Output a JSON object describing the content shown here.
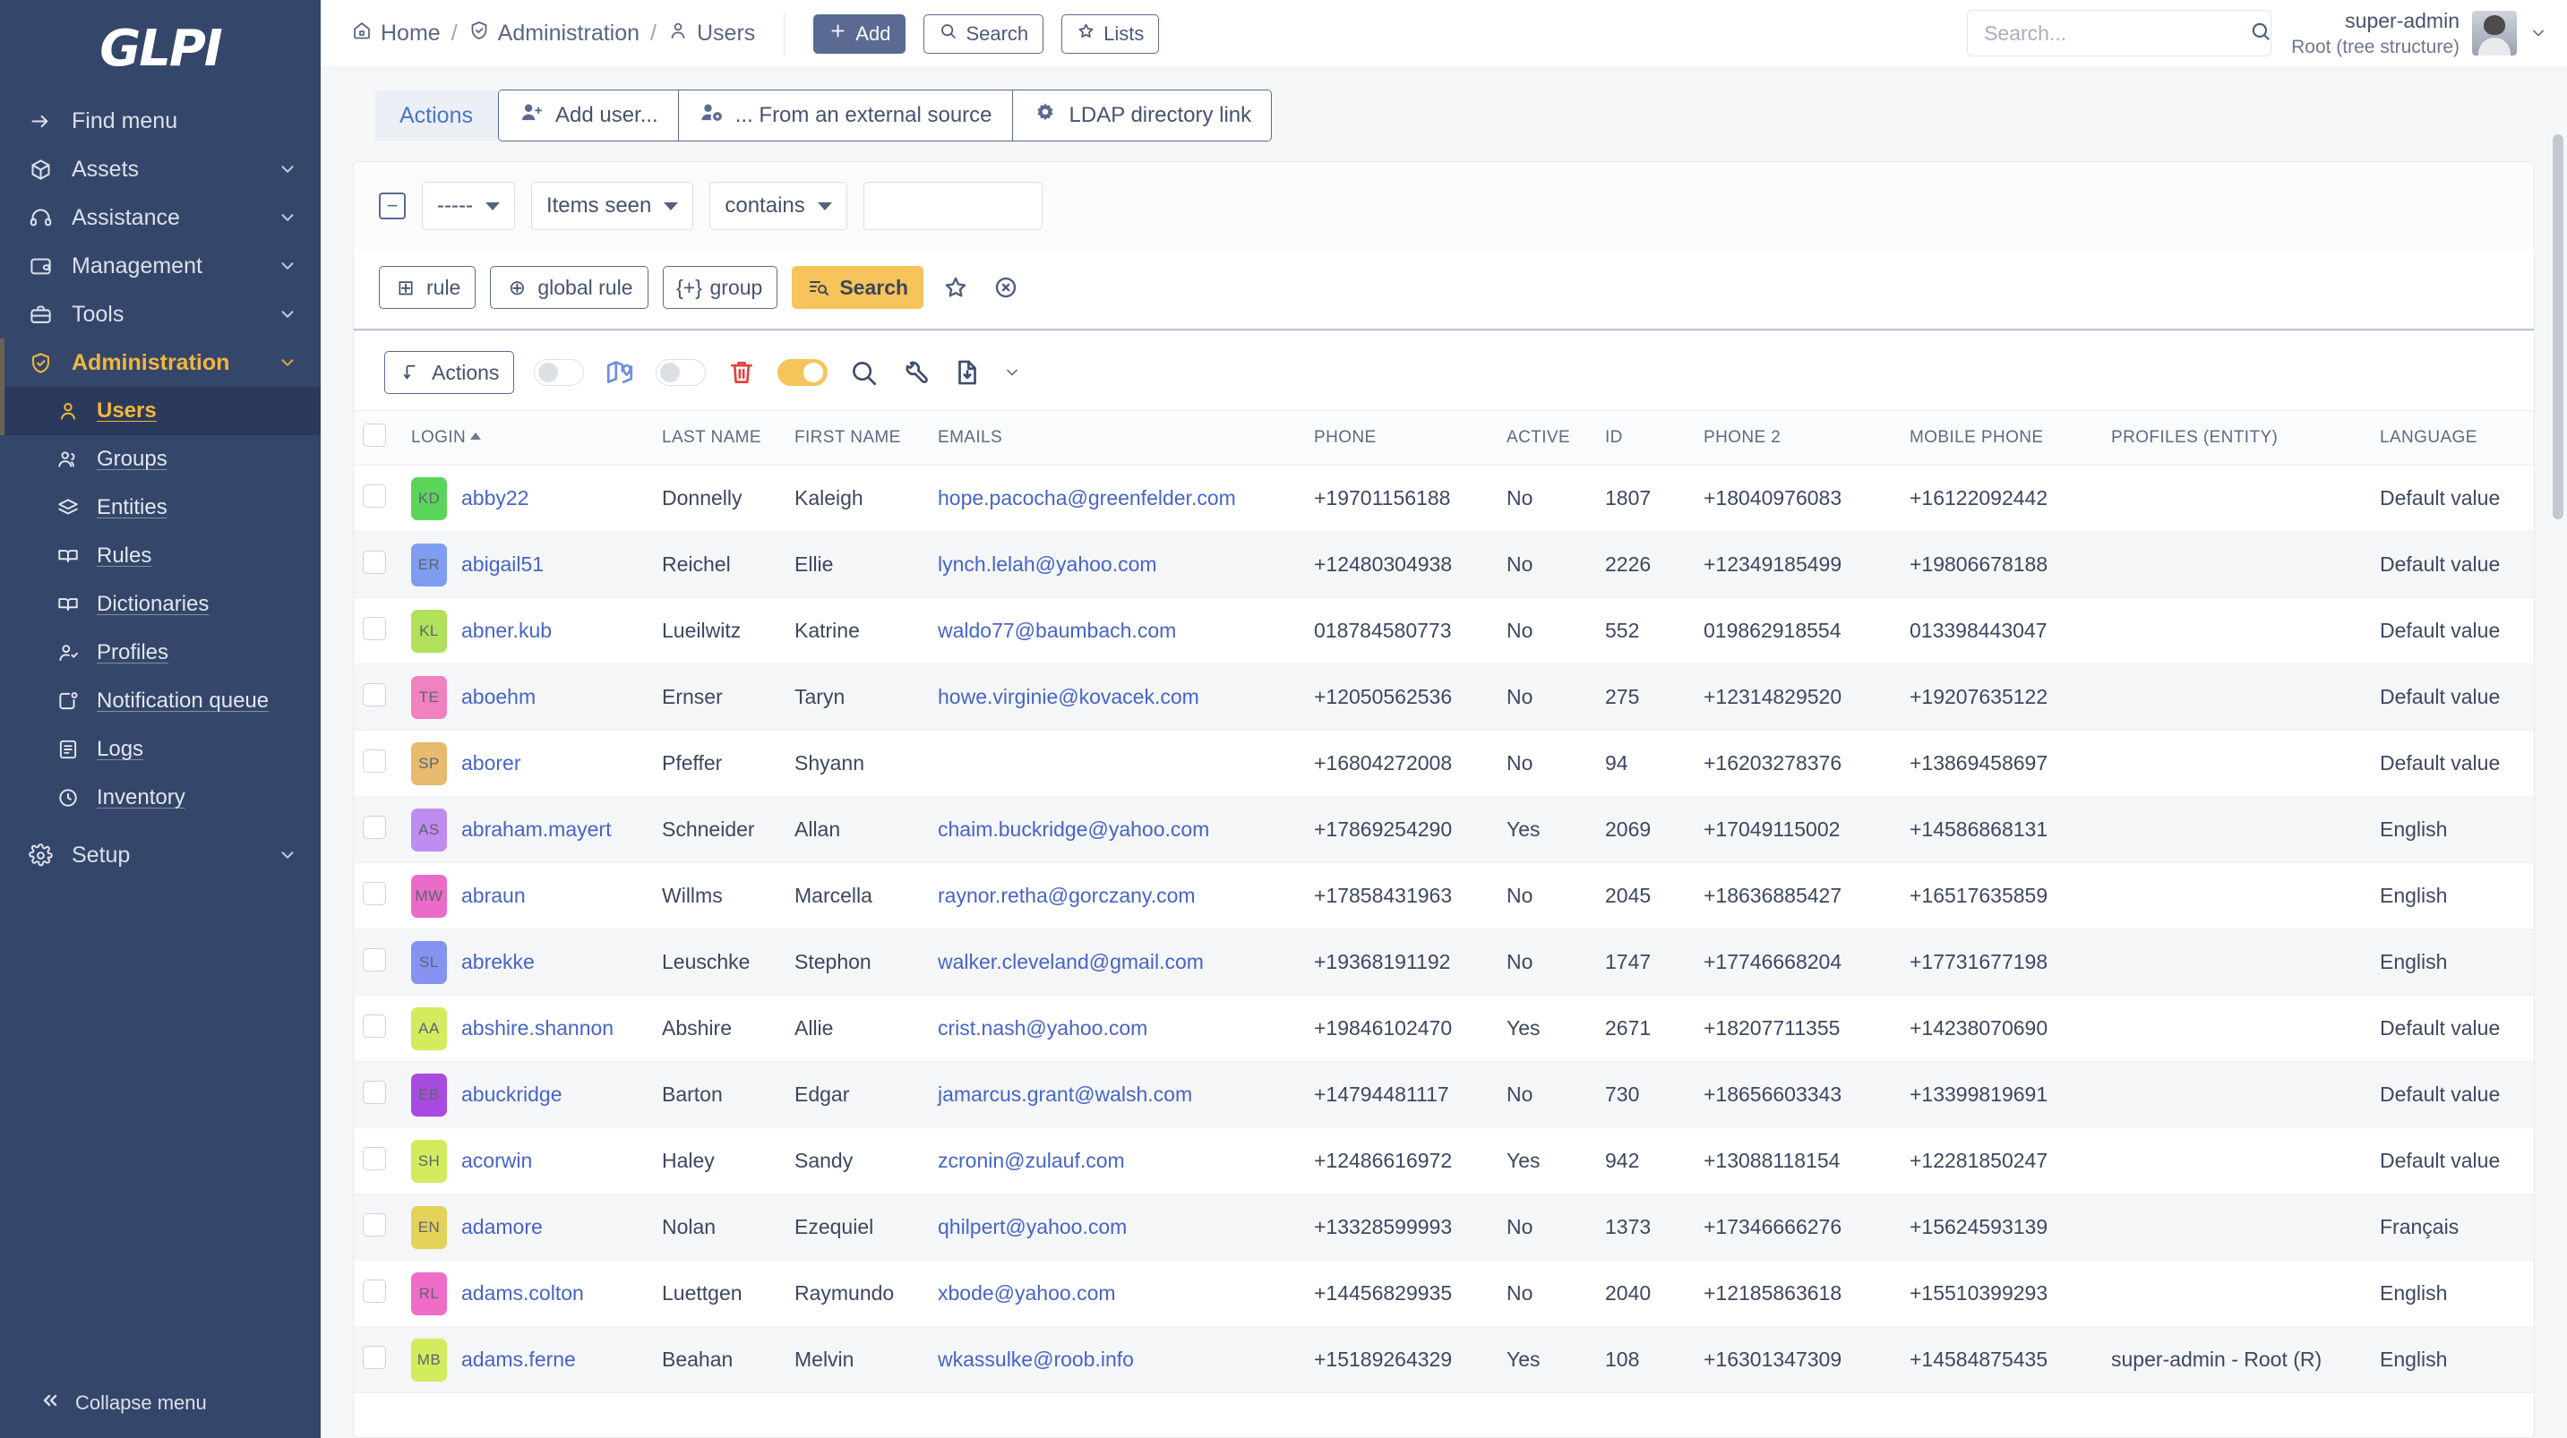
{
  "brand": {
    "logo_text": "GLPI",
    "accent": "#f2b63c",
    "sidebar_bg": "#35466b",
    "link_color": "#4664c8"
  },
  "sidebar": {
    "find_menu": "Find menu",
    "items": [
      {
        "label": "Assets",
        "icon": "box-icon"
      },
      {
        "label": "Assistance",
        "icon": "headset-icon"
      },
      {
        "label": "Management",
        "icon": "wallet-icon"
      },
      {
        "label": "Tools",
        "icon": "briefcase-icon"
      },
      {
        "label": "Administration",
        "icon": "shield-check-icon"
      }
    ],
    "sub_items": [
      {
        "label": "Users",
        "icon": "user-icon",
        "selected": true
      },
      {
        "label": "Groups",
        "icon": "users-icon",
        "selected": false
      },
      {
        "label": "Entities",
        "icon": "layers-icon",
        "selected": false
      },
      {
        "label": "Rules",
        "icon": "book-icon",
        "selected": false
      },
      {
        "label": "Dictionaries",
        "icon": "book-icon",
        "selected": false
      },
      {
        "label": "Profiles",
        "icon": "user-check-icon",
        "selected": false
      },
      {
        "label": "Notification queue",
        "icon": "notification-icon",
        "selected": false
      },
      {
        "label": "Logs",
        "icon": "file-list-icon",
        "selected": false
      },
      {
        "label": "Inventory",
        "icon": "cloud-icon",
        "selected": false
      }
    ],
    "setup": {
      "label": "Setup",
      "icon": "gear-icon"
    },
    "collapse": "Collapse menu"
  },
  "header": {
    "breadcrumb": [
      {
        "label": "Home",
        "icon": "home-icon"
      },
      {
        "label": "Administration",
        "icon": "shield-check-icon"
      },
      {
        "label": "Users",
        "icon": "user-icon"
      }
    ],
    "separator": "/",
    "buttons": [
      {
        "label": "Add",
        "icon": "plus-icon",
        "primary": true
      },
      {
        "label": "Search",
        "icon": "search-icon",
        "primary": false
      },
      {
        "label": "Lists",
        "icon": "star-icon",
        "primary": false
      }
    ],
    "search_placeholder": "Search...",
    "user": {
      "name": "super-admin",
      "entity": "Root (tree structure)"
    }
  },
  "tabs": {
    "label": "Actions",
    "buttons": [
      {
        "label": "Add user...",
        "icon": "user-plus-icon"
      },
      {
        "label": "... From an external source",
        "icon": "user-cog-icon"
      },
      {
        "label": "LDAP directory link",
        "icon": "gear-icon"
      }
    ]
  },
  "filters": {
    "collapse_glyph": "−",
    "field_select": "-----",
    "criteria_select": "Items seen",
    "operator_select": "contains",
    "value": "",
    "buttons": [
      {
        "label": "rule",
        "glyph": "⊞"
      },
      {
        "label": "global rule",
        "glyph": "⊕"
      },
      {
        "label": "group",
        "glyph": "{+}"
      }
    ],
    "search_button": "Search",
    "star_icon": "star-icon",
    "reset_icon": "reset-circle-icon"
  },
  "toolbar": {
    "actions_label": "Actions",
    "map_toggle": {
      "state": "off",
      "icon": "map-pin-icon"
    },
    "delete_toggle": {
      "state": "off",
      "icon": "trash-icon"
    },
    "search_toggle": {
      "state": "on",
      "icon": "search-icon"
    },
    "wrench_icon": "wrench-icon",
    "export_icon": "file-export-icon"
  },
  "table": {
    "columns": [
      "LOGIN",
      "LAST NAME",
      "FIRST NAME",
      "EMAILS",
      "PHONE",
      "ACTIVE",
      "ID",
      "PHONE 2",
      "MOBILE PHONE",
      "PROFILES (ENTITY)",
      "LANGUAGE"
    ],
    "sort_column": "LOGIN",
    "sort_direction": "asc",
    "rows": [
      {
        "initials": "KD",
        "color": "#5ad45a",
        "login": "abby22",
        "last_name": "Donnelly",
        "first_name": "Kaleigh",
        "email": "hope.pacocha@greenfelder.com",
        "phone": "+19701156188",
        "active": "No",
        "id": "1807",
        "phone2": "+18040976083",
        "mobile": "+16122092442",
        "profiles": "",
        "language": "Default value"
      },
      {
        "initials": "ER",
        "color": "#7f9df0",
        "login": "abigail51",
        "last_name": "Reichel",
        "first_name": "Ellie",
        "email": "lynch.lelah@yahoo.com",
        "phone": "+12480304938",
        "active": "No",
        "id": "2226",
        "phone2": "+12349185499",
        "mobile": "+19806678188",
        "profiles": "",
        "language": "Default value"
      },
      {
        "initials": "KL",
        "color": "#b3e05a",
        "login": "abner.kub",
        "last_name": "Lueilwitz",
        "first_name": "Katrine",
        "email": "waldo77@baumbach.com",
        "phone": "018784580773",
        "active": "No",
        "id": "552",
        "phone2": "019862918554",
        "mobile": "013398443047",
        "profiles": "",
        "language": "Default value"
      },
      {
        "initials": "TE",
        "color": "#ef82bf",
        "login": "aboehm",
        "last_name": "Ernser",
        "first_name": "Taryn",
        "email": "howe.virginie@kovacek.com",
        "phone": "+12050562536",
        "active": "No",
        "id": "275",
        "phone2": "+12314829520",
        "mobile": "+19207635122",
        "profiles": "",
        "language": "Default value"
      },
      {
        "initials": "SP",
        "color": "#e7ba6d",
        "login": "aborer",
        "last_name": "Pfeffer",
        "first_name": "Shyann",
        "email": "",
        "phone": "+16804272008",
        "active": "No",
        "id": "94",
        "phone2": "+16203278376",
        "mobile": "+13869458697",
        "profiles": "",
        "language": "Default value"
      },
      {
        "initials": "AS",
        "color": "#c08cef",
        "login": "abraham.mayert",
        "last_name": "Schneider",
        "first_name": "Allan",
        "email": "chaim.buckridge@yahoo.com",
        "phone": "+17869254290",
        "active": "Yes",
        "id": "2069",
        "phone2": "+17049115002",
        "mobile": "+14586868131",
        "profiles": "",
        "language": "English"
      },
      {
        "initials": "MW",
        "color": "#ea6cc8",
        "login": "abraun",
        "last_name": "Willms",
        "first_name": "Marcella",
        "email": "raynor.retha@gorczany.com",
        "phone": "+17858431963",
        "active": "No",
        "id": "2045",
        "phone2": "+18636885427",
        "mobile": "+16517635859",
        "profiles": "",
        "language": "English"
      },
      {
        "initials": "SL",
        "color": "#8592ef",
        "login": "abrekke",
        "last_name": "Leuschke",
        "first_name": "Stephon",
        "email": "walker.cleveland@gmail.com",
        "phone": "+19368191192",
        "active": "No",
        "id": "1747",
        "phone2": "+17746668204",
        "mobile": "+17731677198",
        "profiles": "",
        "language": "English"
      },
      {
        "initials": "AA",
        "color": "#d2ec5e",
        "login": "abshire.shannon",
        "last_name": "Abshire",
        "first_name": "Allie",
        "email": "crist.nash@yahoo.com",
        "phone": "+19846102470",
        "active": "Yes",
        "id": "2671",
        "phone2": "+18207711355",
        "mobile": "+14238070690",
        "profiles": "",
        "language": "Default value"
      },
      {
        "initials": "EB",
        "color": "#a94ae0",
        "login": "abuckridge",
        "last_name": "Barton",
        "first_name": "Edgar",
        "email": "jamarcus.grant@walsh.com",
        "phone": "+14794481117",
        "active": "No",
        "id": "730",
        "phone2": "+18656603343",
        "mobile": "+13399819691",
        "profiles": "",
        "language": "Default value"
      },
      {
        "initials": "SH",
        "color": "#d2ec5e",
        "login": "acorwin",
        "last_name": "Haley",
        "first_name": "Sandy",
        "email": "zcronin@zulauf.com",
        "phone": "+12486616972",
        "active": "Yes",
        "id": "942",
        "phone2": "+13088118154",
        "mobile": "+12281850247",
        "profiles": "",
        "language": "Default value"
      },
      {
        "initials": "EN",
        "color": "#e3d158",
        "login": "adamore",
        "last_name": "Nolan",
        "first_name": "Ezequiel",
        "email": "qhilpert@yahoo.com",
        "phone": "+13328599993",
        "active": "No",
        "id": "1373",
        "phone2": "+17346666276",
        "mobile": "+15624593139",
        "profiles": "",
        "language": "Français"
      },
      {
        "initials": "RL",
        "color": "#ef6cc8",
        "login": "adams.colton",
        "last_name": "Luettgen",
        "first_name": "Raymundo",
        "email": "xbode@yahoo.com",
        "phone": "+14456829935",
        "active": "No",
        "id": "2040",
        "phone2": "+12185863618",
        "mobile": "+15510399293",
        "profiles": "",
        "language": "English"
      },
      {
        "initials": "MB",
        "color": "#d2ec5e",
        "login": "adams.ferne",
        "last_name": "Beahan",
        "first_name": "Melvin",
        "email": "wkassulke@roob.info",
        "phone": "+15189264329",
        "active": "Yes",
        "id": "108",
        "phone2": "+16301347309",
        "mobile": "+14584875435",
        "profiles": "super-admin - Root (R)",
        "language": "English"
      }
    ]
  }
}
